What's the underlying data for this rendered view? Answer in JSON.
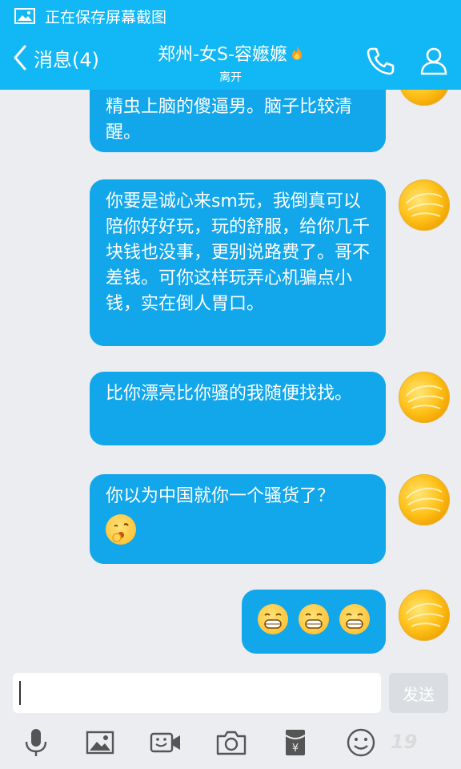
{
  "status_bar": {
    "text": "正在保存屏幕截图"
  },
  "header": {
    "back_label": "消息(4)",
    "title": "郑州-女S-容嬷嬷",
    "subtitle": "离开"
  },
  "messages": [
    {
      "text": "精虫上脑的傻逼男。脑子比较清醒。"
    },
    {
      "text": "你要是诚心来sm玩，我倒真可以陪你好好玩，玩的舒服，给你几千块钱也没事，更别说路费了。哥不差钱。可你这样玩弄心机骗点小钱，实在倒人胃口。"
    },
    {
      "text": "比你漂亮比你骚的我随便找找。"
    },
    {
      "text": "你以为中国就你一个骚货了？"
    }
  ],
  "input": {
    "value": "",
    "send_label": "发送"
  },
  "watermark": "19"
}
